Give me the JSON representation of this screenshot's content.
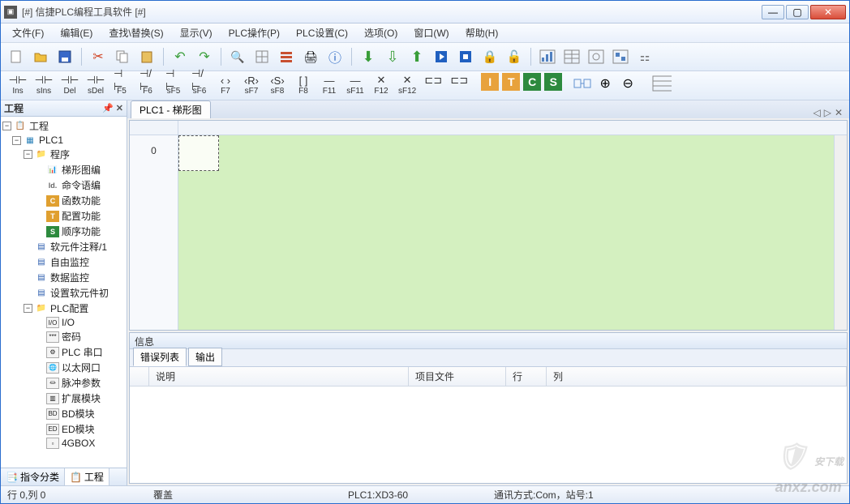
{
  "title": "[#] 信捷PLC编程工具软件 [#]",
  "menus": [
    "文件(F)",
    "编辑(E)",
    "查找\\替换(S)",
    "显示(V)",
    "PLC操作(P)",
    "PLC设置(C)",
    "选项(O)",
    "窗口(W)",
    "帮助(H)"
  ],
  "toolbar2": [
    {
      "icon": "⊣⊢",
      "label": "Ins"
    },
    {
      "icon": "⊣⊢",
      "label": "sIns"
    },
    {
      "icon": "⊣⊢",
      "label": "Del"
    },
    {
      "icon": "⊣⊢",
      "label": "sDel"
    },
    {
      "icon": "⊣ ⊢",
      "label": "F5"
    },
    {
      "icon": "⊣/⊢",
      "label": "F6"
    },
    {
      "icon": "⊣ ⊢",
      "label": "sF5"
    },
    {
      "icon": "⊣/⊢",
      "label": "sF6"
    },
    {
      "icon": "‹ ›",
      "label": "F7"
    },
    {
      "icon": "‹R›",
      "label": "sF7"
    },
    {
      "icon": "‹S›",
      "label": "sF8"
    },
    {
      "icon": "[ ]",
      "label": "F8"
    },
    {
      "icon": "—",
      "label": "F11"
    },
    {
      "icon": "—",
      "label": "sF11"
    },
    {
      "icon": "✕",
      "label": "F12"
    },
    {
      "icon": "✕",
      "label": "sF12"
    }
  ],
  "letters": [
    {
      "t": "I",
      "bg": "#e8a23c"
    },
    {
      "t": "T",
      "bg": "#e8a23c"
    },
    {
      "t": "C",
      "bg": "#2d8a3e"
    },
    {
      "t": "S",
      "bg": "#2d8a3e"
    }
  ],
  "sidepanel": {
    "title": "工程"
  },
  "tree": {
    "root": "工程",
    "plc": "PLC1",
    "prog": "程序",
    "prog_children": [
      "梯形图编",
      "命令语编",
      "函数功能",
      "配置功能",
      "顺序功能"
    ],
    "items": [
      "软元件注释/1",
      "自由监控",
      "数据监控",
      "设置软元件初"
    ],
    "cfg": "PLC配置",
    "cfg_children": [
      "I/O",
      "密码",
      "PLC 串口",
      "以太网口",
      "脉冲参数",
      "扩展模块",
      "BD模块",
      "ED模块",
      "4GBOX"
    ]
  },
  "panetabs": [
    "指令分类",
    "工程"
  ],
  "doctab": "PLC1 - 梯形图",
  "rownum": "0",
  "info": {
    "title": "信息",
    "tabs": [
      "错误列表",
      "输出"
    ],
    "cols": [
      "说明",
      "项目文件",
      "行",
      "列"
    ]
  },
  "status": {
    "pos": "行 0,列 0",
    "mode": "覆盖",
    "plc": "PLC1:XD3-60",
    "comm": "通讯方式:Com，站号:1"
  },
  "watermark": {
    "site": "anxz.com",
    "brand": "安下载"
  }
}
